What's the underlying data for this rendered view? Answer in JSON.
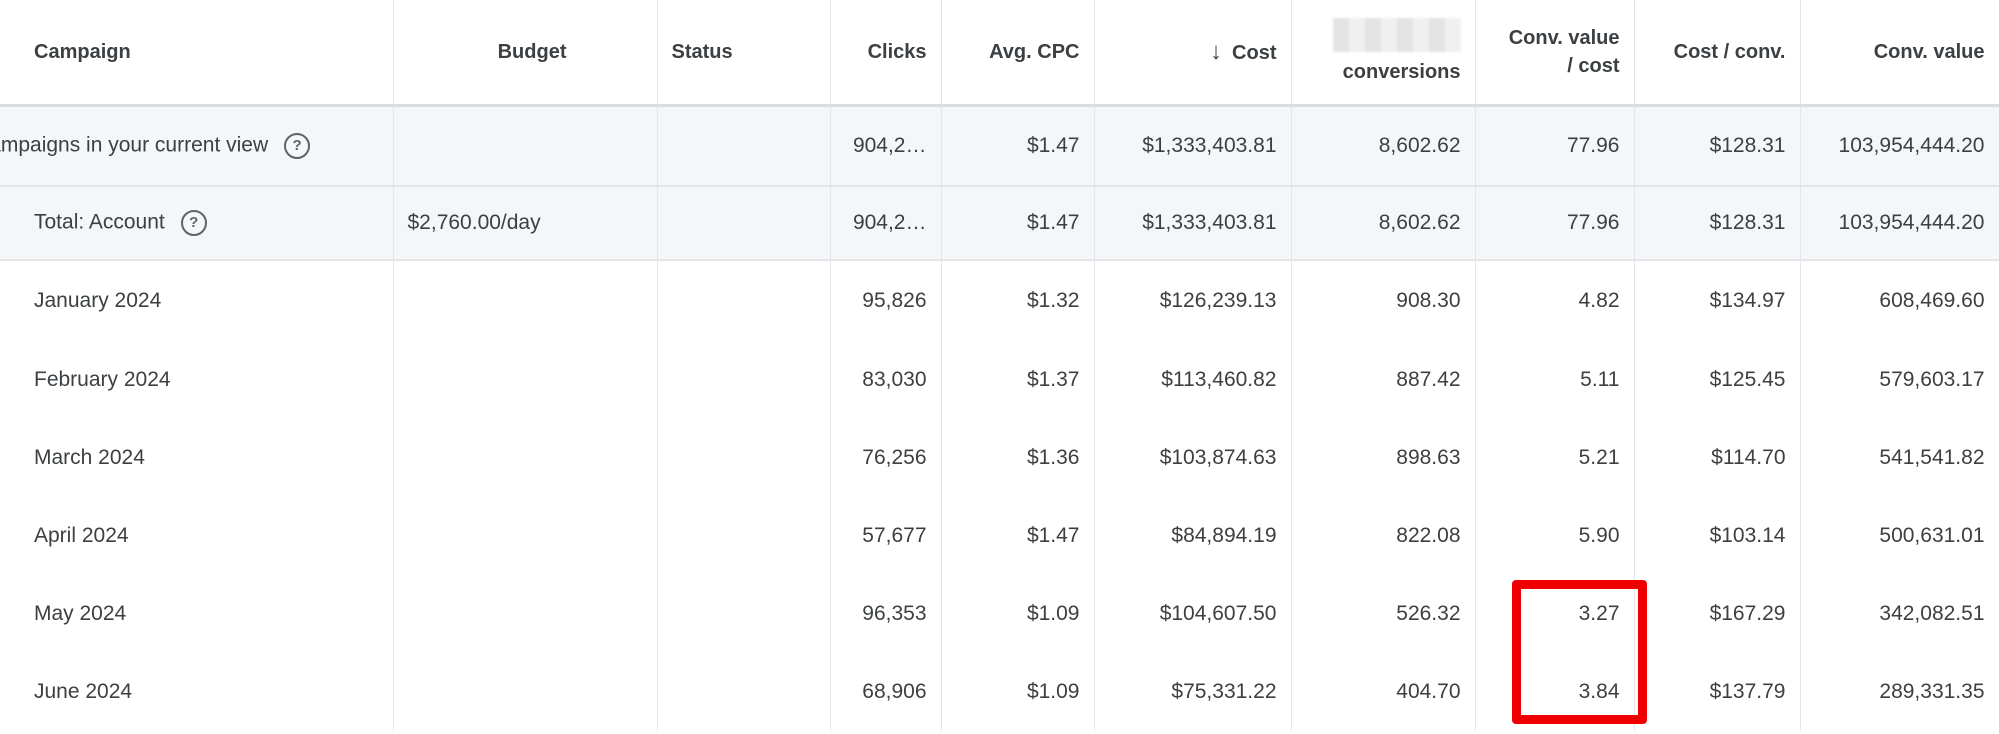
{
  "columns": {
    "campaign": "Campaign",
    "budget": "Budget",
    "status": "Status",
    "clicks": "Clicks",
    "avg_cpc": "Avg. CPC",
    "cost": "Cost",
    "conversions_bottom": "conversions",
    "conv_value_cost_line1": "Conv. value",
    "conv_value_cost_line2": "/ cost",
    "cost_per_conv": "Cost / conv.",
    "conv_value": "Conv. value",
    "sort_icon": "arrow-down-icon",
    "help_icon": "help-circle-icon"
  },
  "summary": [
    {
      "campaign": "Campaigns in your current view",
      "budget": "",
      "status": "",
      "clicks": "904,2…",
      "avg_cpc": "$1.47",
      "cost": "$1,333,403.81",
      "conversions": "8,602.62",
      "conv_value_cost": "77.96",
      "cost_per_conv": "$128.31",
      "conv_value": "103,954,444.20"
    },
    {
      "campaign": "Total: Account",
      "budget": "$2,760.00/day",
      "status": "",
      "clicks": "904,2…",
      "avg_cpc": "$1.47",
      "cost": "$1,333,403.81",
      "conversions": "8,602.62",
      "conv_value_cost": "77.96",
      "cost_per_conv": "$128.31",
      "conv_value": "103,954,444.20"
    }
  ],
  "rows": [
    {
      "campaign": "January 2024",
      "clicks": "95,826",
      "avg_cpc": "$1.32",
      "cost": "$126,239.13",
      "conversions": "908.30",
      "conv_value_cost": "4.82",
      "cost_per_conv": "$134.97",
      "conv_value": "608,469.60"
    },
    {
      "campaign": "February 2024",
      "clicks": "83,030",
      "avg_cpc": "$1.37",
      "cost": "$113,460.82",
      "conversions": "887.42",
      "conv_value_cost": "5.11",
      "cost_per_conv": "$125.45",
      "conv_value": "579,603.17"
    },
    {
      "campaign": "March 2024",
      "clicks": "76,256",
      "avg_cpc": "$1.36",
      "cost": "$103,874.63",
      "conversions": "898.63",
      "conv_value_cost": "5.21",
      "cost_per_conv": "$114.70",
      "conv_value": "541,541.82"
    },
    {
      "campaign": "April 2024",
      "clicks": "57,677",
      "avg_cpc": "$1.47",
      "cost": "$84,894.19",
      "conversions": "822.08",
      "conv_value_cost": "5.90",
      "cost_per_conv": "$103.14",
      "conv_value": "500,631.01"
    },
    {
      "campaign": "May 2024",
      "clicks": "96,353",
      "avg_cpc": "$1.09",
      "cost": "$104,607.50",
      "conversions": "526.32",
      "conv_value_cost": "3.27",
      "cost_per_conv": "$167.29",
      "conv_value": "342,082.51"
    },
    {
      "campaign": "June 2024",
      "clicks": "68,906",
      "avg_cpc": "$1.09",
      "cost": "$75,331.22",
      "conversions": "404.70",
      "conv_value_cost": "3.84",
      "cost_per_conv": "$137.79",
      "conv_value": "289,331.35"
    }
  ],
  "highlight_color": "#ee0000"
}
